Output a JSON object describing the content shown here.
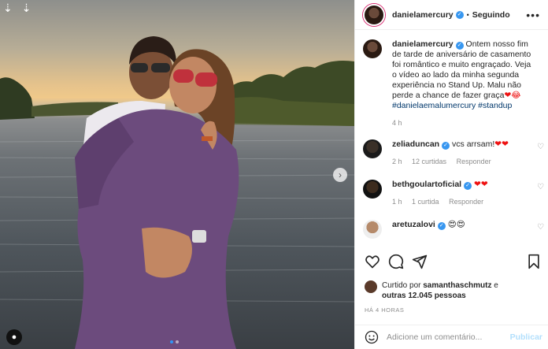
{
  "photo": {
    "top_icons": "⇣ ⇣",
    "carousel_next_icon": "chevron-right",
    "carousel_dots": 2,
    "active_dot": 0
  },
  "header": {
    "username": "danielamercury",
    "separator": "•",
    "follow_status": "Seguindo",
    "menu_icon": "•••"
  },
  "caption": {
    "username": "danielamercury",
    "text": "Ontem nosso fim de tarde de aniversário de casamento foi romântico e muito engraçado. Veja o vídeo ao lado da minha segunda experiência no Stand Up. Malu não perde a chance de fazer graça",
    "emojis": "❤😂",
    "hashtags": "#danielaemalumercury #standup",
    "time": "4 h"
  },
  "comments": [
    {
      "username": "zeliaduncan",
      "text": "vcs arrsam!",
      "emojis": "❤❤",
      "time": "2 h",
      "likes": "12 curtidas",
      "reply": "Responder"
    },
    {
      "username": "bethgoulartoficial",
      "text": "",
      "emojis": "❤❤",
      "time": "1 h",
      "likes": "1 curtida",
      "reply": "Responder"
    },
    {
      "username": "aretuzalovi",
      "text": "",
      "emojis": "😍😍",
      "time": "",
      "likes": "",
      "reply": ""
    }
  ],
  "likes": {
    "prefix": "Curtido por",
    "user": "samanthaschmutz",
    "connector": "e",
    "others": "outras 12.045 pessoas"
  },
  "timestamp": "HÁ 4 HORAS",
  "add_comment": {
    "placeholder": "Adicione um comentário...",
    "publish": "Publicar"
  },
  "colors": {
    "verified": "#3897f0",
    "link": "#00376b",
    "muted": "#8e8e8e",
    "publish_disabled": "#b2dffc"
  }
}
